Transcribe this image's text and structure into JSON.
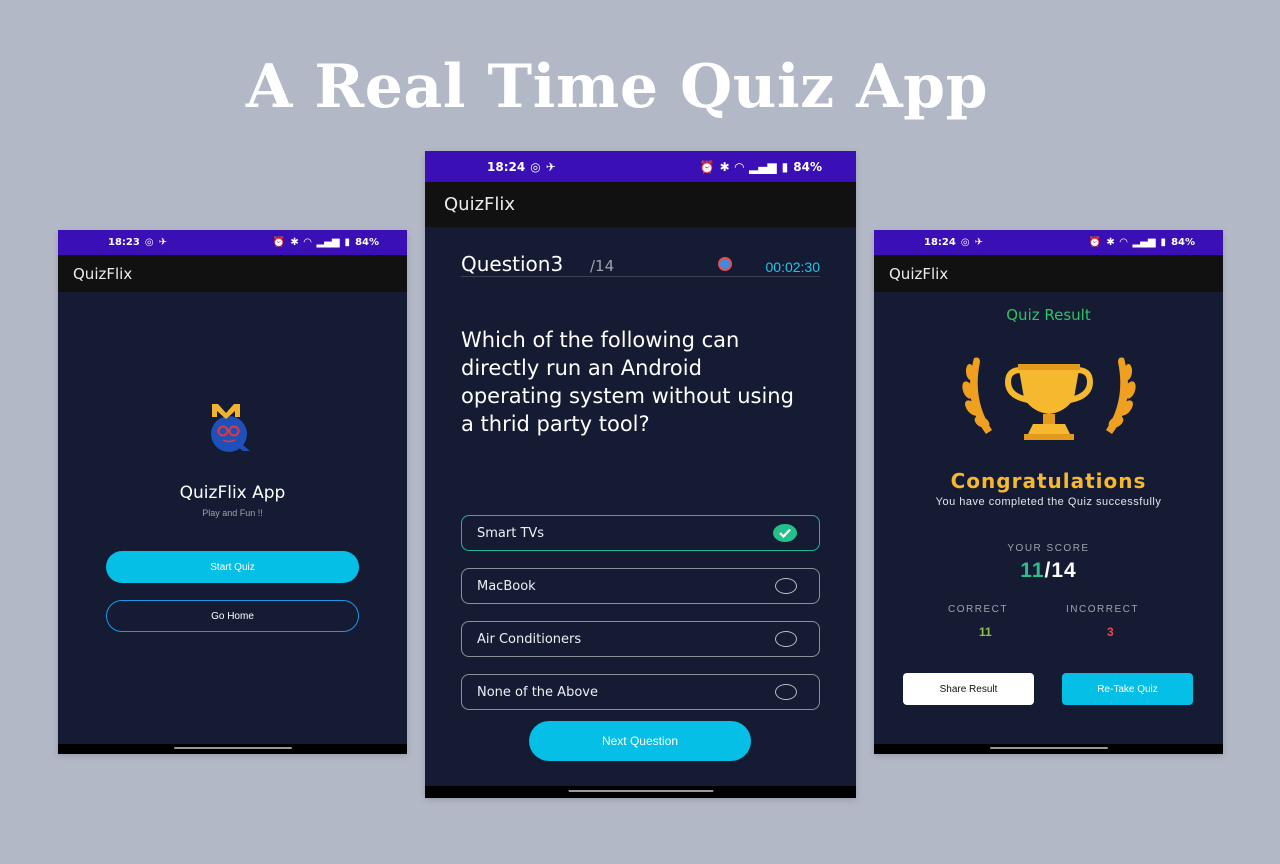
{
  "headline": "A Real Time Quiz App",
  "colors": {
    "background": "#b3b8c7",
    "status_bar": "#3a0fb5",
    "app_bar": "#111111",
    "screen": "#141b33",
    "accent_cyan": "#05bfe6",
    "correct_green": "#2bbf8a",
    "gold": "#f5b82e"
  },
  "home_screen": {
    "status_time": "18:23",
    "status_battery": "84%",
    "app_title": "QuizFlix",
    "logo_letters": "MQ",
    "app_name": "QuizFlix App",
    "tagline": "Play and Fun !!",
    "start_button": "Start Quiz",
    "home_button": "Go Home"
  },
  "question_screen": {
    "status_time": "18:24",
    "status_battery": "84%",
    "app_title": "QuizFlix",
    "question_label": "Question3",
    "question_total": "/14",
    "timer": "00:02:30",
    "question_text": "Which of the following can directly run an Android operating system without using a thrid party tool?",
    "options": [
      {
        "label": "Smart TVs",
        "selected": true
      },
      {
        "label": "MacBook",
        "selected": false
      },
      {
        "label": "Air Conditioners",
        "selected": false
      },
      {
        "label": "None of the Above",
        "selected": false
      }
    ],
    "next_button": "Next Question"
  },
  "result_screen": {
    "status_time": "18:24",
    "status_battery": "84%",
    "app_title": "QuizFlix",
    "result_title": "Quiz Result",
    "congrats": "Congratulations",
    "message": "You have completed the Quiz successfully",
    "score_label": "YOUR SCORE",
    "score_value": "11",
    "score_total": "/14",
    "correct_label": "CORRECT",
    "correct_value": "11",
    "incorrect_label": "INCORRECT",
    "incorrect_value": "3",
    "share_button": "Share Result",
    "retake_button": "Re-Take Quiz"
  }
}
